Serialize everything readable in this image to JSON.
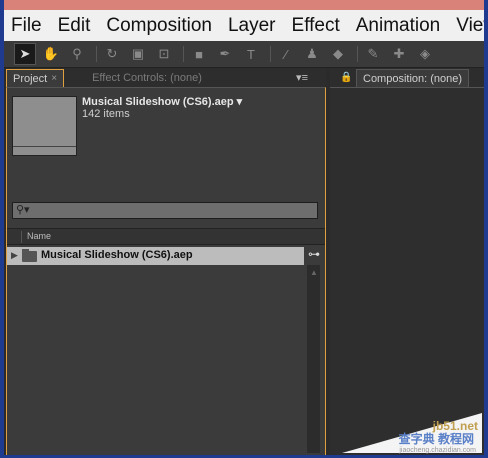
{
  "menu": [
    "File",
    "Edit",
    "Composition",
    "Layer",
    "Effect",
    "Animation",
    "View"
  ],
  "project_panel": {
    "tab_label": "Project",
    "tab_close": "×",
    "effects_tab": "Effect Controls: (none)",
    "project_name": "Musical Slideshow (CS6).aep ▾",
    "item_count": "142 items",
    "column_name": "Name",
    "row_label": "Musical Slideshow (CS6).aep"
  },
  "comp_panel": {
    "tab_label": "Composition: (none)"
  },
  "watermark": {
    "site": "jb51.net",
    "text": "查字典 教程网",
    "url": "jiaocheng.chazidian.com"
  },
  "colors": {
    "accent": "#e0a040",
    "frame": "#1f3b8f"
  }
}
